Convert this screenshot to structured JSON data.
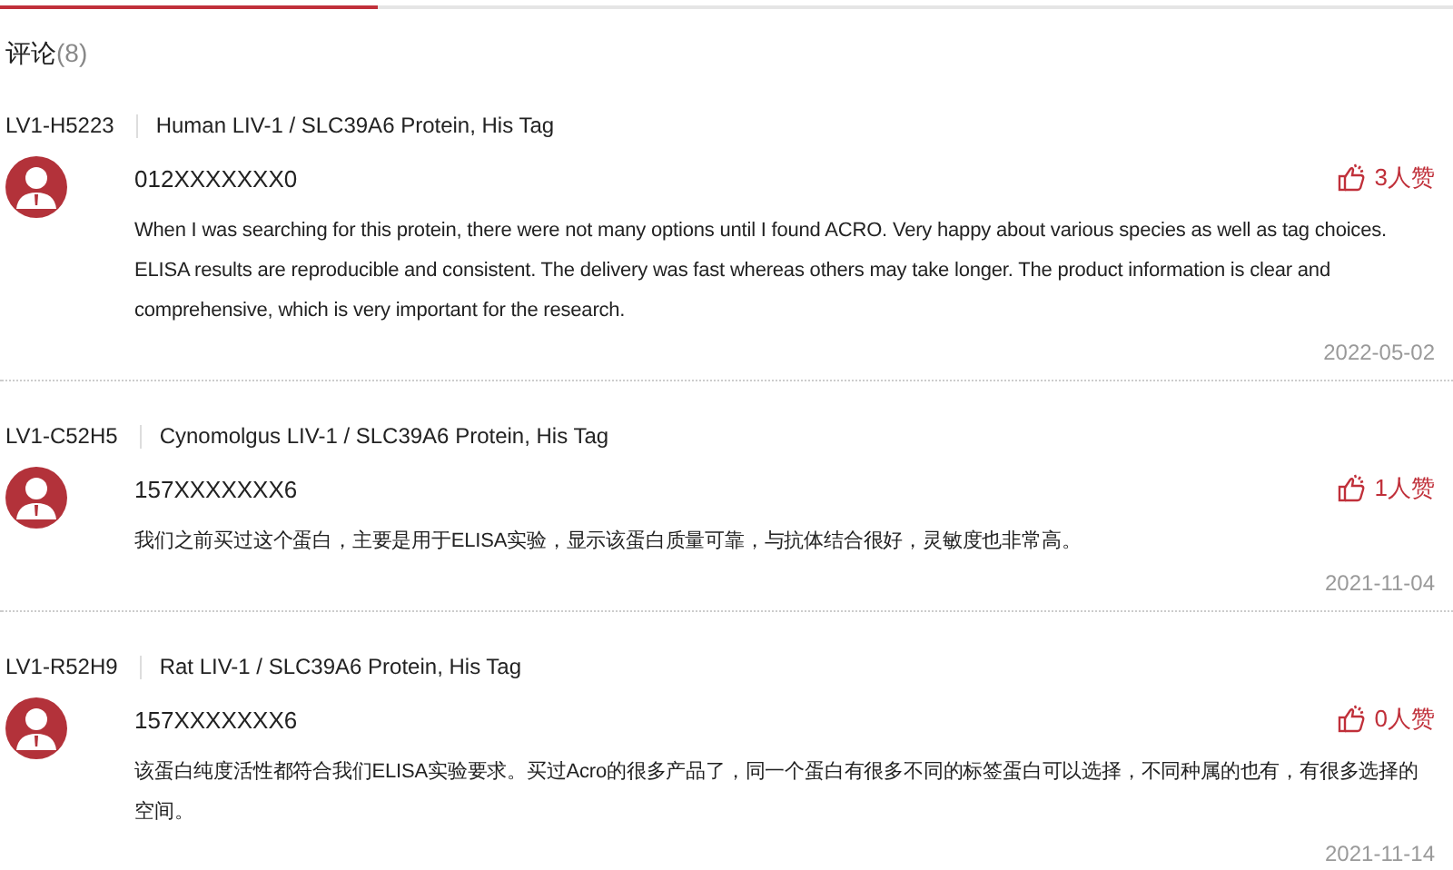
{
  "tabs_bar": {
    "level": 0.26
  },
  "section": {
    "title": "评论",
    "count": "(8)"
  },
  "reviews": [
    {
      "sku": "LV1-H5223",
      "product": "Human LIV-1 / SLC39A6 Protein, His Tag",
      "user": "012XXXXXXX0",
      "likes": "3人赞",
      "text": "When I was searching for this protein, there were not many options until I found ACRO. Very happy about various species as well as tag choices. ELISA results are reproducible and consistent. The delivery was fast whereas others may take longer. The product information is clear and comprehensive, which is very important for the research.",
      "date": "2022-05-02"
    },
    {
      "sku": "LV1-C52H5",
      "product": "Cynomolgus LIV-1 / SLC39A6 Protein, His Tag",
      "user": "157XXXXXXX6",
      "likes": "1人赞",
      "text": "我们之前买过这个蛋白，主要是用于ELISA实验，显示该蛋白质量可靠，与抗体结合很好，灵敏度也非常高。",
      "date": "2021-11-04"
    },
    {
      "sku": "LV1-R52H9",
      "product": "Rat LIV-1 / SLC39A6 Protein, His Tag",
      "user": "157XXXXXXX6",
      "likes": "0人赞",
      "text": "该蛋白纯度活性都符合我们ELISA实验要求。买过Acro的很多产品了，同一个蛋白有很多不同的标签蛋白可以选择，不同种属的也有，有很多选择的空间。",
      "date": "2021-11-14"
    }
  ]
}
